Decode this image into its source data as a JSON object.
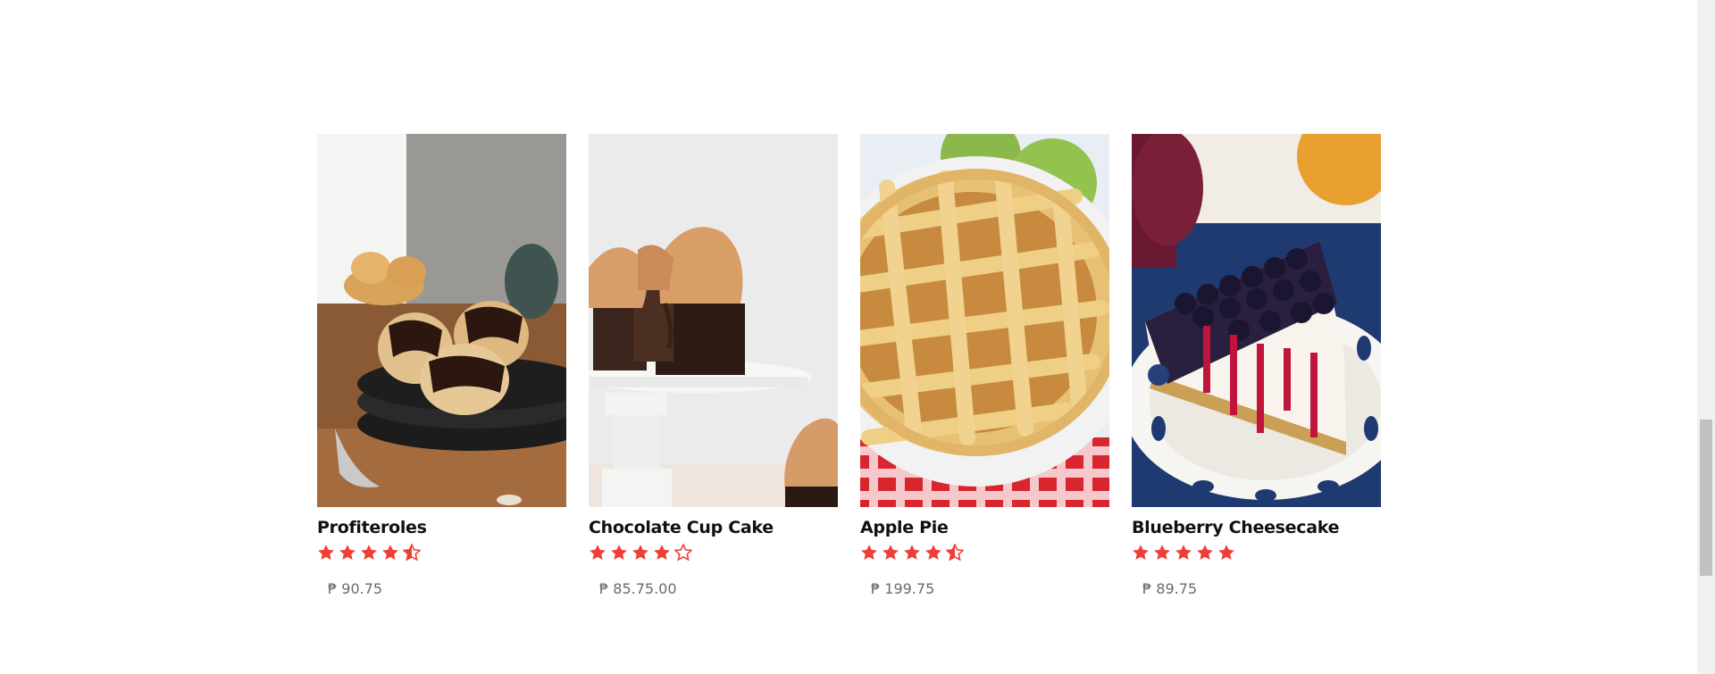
{
  "products": [
    {
      "name": "Profiteroles",
      "rating": 4.5,
      "price": "₱ 90.75",
      "image_icon": "profiteroles-photo"
    },
    {
      "name": "Chocolate Cup Cake",
      "rating": 4,
      "price": "₱ 85.75.00",
      "image_icon": "cupcake-photo"
    },
    {
      "name": "Apple Pie",
      "rating": 4.5,
      "price": "₱ 199.75",
      "image_icon": "apple-pie-photo"
    },
    {
      "name": "Blueberry Cheesecake",
      "rating": 5,
      "price": "₱ 89.75",
      "image_icon": "cheesecake-photo"
    }
  ],
  "colors": {
    "star": "#ef3e36",
    "name": "#111111",
    "price": "#6a6a6a"
  }
}
